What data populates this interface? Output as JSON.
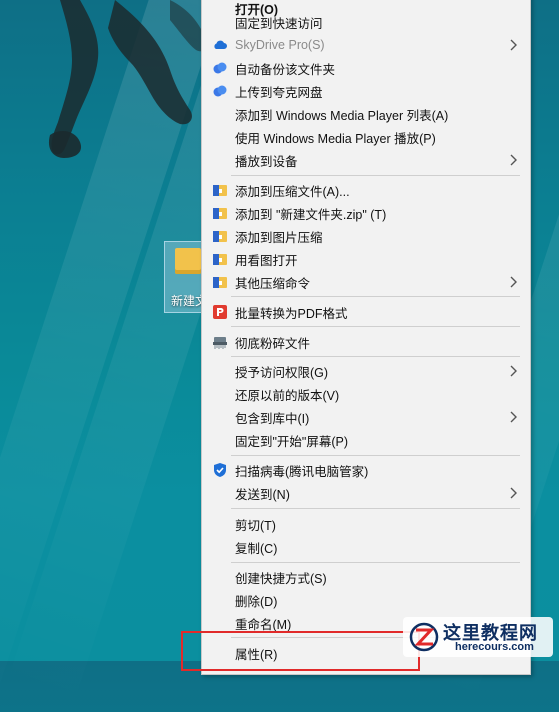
{
  "desktop": {
    "icon_label": "新建文"
  },
  "context_menu": {
    "items": [
      {
        "label": "打开(O)",
        "icon": "",
        "submenu": false,
        "disabled": false
      },
      {
        "label": "固定到快速访问",
        "icon": "",
        "submenu": false,
        "disabled": false
      },
      {
        "label": "SkyDrive Pro(S)",
        "icon": "cloud-icon",
        "submenu": true,
        "disabled": true
      },
      {
        "label": "自动备份该文件夹",
        "icon": "cloud-backup-icon",
        "submenu": false,
        "disabled": false
      },
      {
        "label": "上传到夸克网盘",
        "icon": "cloud-upload-icon",
        "submenu": false,
        "disabled": false
      },
      {
        "label": "添加到 Windows Media Player 列表(A)",
        "icon": "",
        "submenu": false,
        "disabled": false
      },
      {
        "label": "使用 Windows Media Player 播放(P)",
        "icon": "",
        "submenu": false,
        "disabled": false
      },
      {
        "label": "播放到设备",
        "icon": "",
        "submenu": true,
        "disabled": false
      },
      {
        "label": "添加到压缩文件(A)...",
        "icon": "archive-icon",
        "submenu": false,
        "disabled": false
      },
      {
        "label": "添加到 \"新建文件夹.zip\" (T)",
        "icon": "archive-icon",
        "submenu": false,
        "disabled": false
      },
      {
        "label": "添加到图片压缩",
        "icon": "archive-icon",
        "submenu": false,
        "disabled": false
      },
      {
        "label": "用看图打开",
        "icon": "archive-icon",
        "submenu": false,
        "disabled": false
      },
      {
        "label": "其他压缩命令",
        "icon": "archive-icon",
        "submenu": true,
        "disabled": false
      },
      {
        "label": "批量转换为PDF格式",
        "icon": "pdf-convert-icon",
        "submenu": false,
        "disabled": false
      },
      {
        "label": "彻底粉碎文件",
        "icon": "shredder-icon",
        "submenu": false,
        "disabled": false
      },
      {
        "label": "授予访问权限(G)",
        "icon": "",
        "submenu": true,
        "disabled": false
      },
      {
        "label": "还原以前的版本(V)",
        "icon": "",
        "submenu": false,
        "disabled": false
      },
      {
        "label": "包含到库中(I)",
        "icon": "",
        "submenu": true,
        "disabled": false
      },
      {
        "label": "固定到\"开始\"屏幕(P)",
        "icon": "",
        "submenu": false,
        "disabled": false
      },
      {
        "label": "扫描病毒(腾讯电脑管家)",
        "icon": "shield-icon",
        "submenu": false,
        "disabled": false
      },
      {
        "label": "发送到(N)",
        "icon": "",
        "submenu": true,
        "disabled": false
      },
      {
        "label": "剪切(T)",
        "icon": "",
        "submenu": false,
        "disabled": false
      },
      {
        "label": "复制(C)",
        "icon": "",
        "submenu": false,
        "disabled": false
      },
      {
        "label": "创建快捷方式(S)",
        "icon": "",
        "submenu": false,
        "disabled": false
      },
      {
        "label": "删除(D)",
        "icon": "",
        "submenu": false,
        "disabled": false
      },
      {
        "label": "重命名(M)",
        "icon": "",
        "submenu": false,
        "disabled": false
      },
      {
        "label": "属性(R)",
        "icon": "",
        "submenu": false,
        "disabled": false
      }
    ]
  },
  "watermark": {
    "title": "这里教程网",
    "url": "herecours.com"
  },
  "colors": {
    "menu_bg": "#f2f2f2",
    "highlight": "#e12a2a",
    "accent_blue": "#1f6fd6"
  }
}
